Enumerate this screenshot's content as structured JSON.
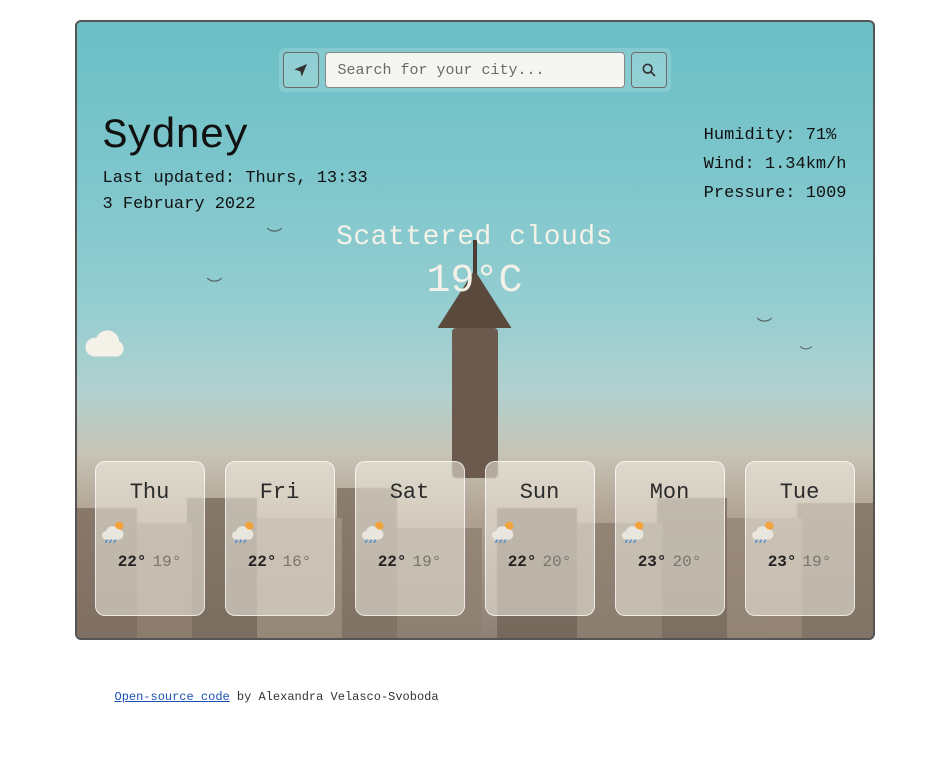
{
  "search": {
    "placeholder": "Search for your city..."
  },
  "location": {
    "city": "Sydney",
    "last_updated": "Last updated: Thurs, 13:33",
    "date": "3 February 2022"
  },
  "stats": {
    "humidity": "Humidity: 71%",
    "wind": "Wind: 1.34km/h",
    "pressure": "Pressure: 1009"
  },
  "current": {
    "condition": "Scattered clouds",
    "temperature": "19°C",
    "icon": "cloud-icon"
  },
  "forecast": [
    {
      "day": "Thu",
      "hi": "22°",
      "lo": "19°",
      "icon": "rain-sun"
    },
    {
      "day": "Fri",
      "hi": "22°",
      "lo": "16°",
      "icon": "rain-sun"
    },
    {
      "day": "Sat",
      "hi": "22°",
      "lo": "19°",
      "icon": "rain-sun"
    },
    {
      "day": "Sun",
      "hi": "22°",
      "lo": "20°",
      "icon": "rain-sun"
    },
    {
      "day": "Mon",
      "hi": "23°",
      "lo": "20°",
      "icon": "rain-sun"
    },
    {
      "day": "Tue",
      "hi": "23°",
      "lo": "19°",
      "icon": "rain-sun"
    }
  ],
  "footer": {
    "link_text": "Open-source code",
    "by_text": " by Alexandra Velasco-Svoboda"
  }
}
